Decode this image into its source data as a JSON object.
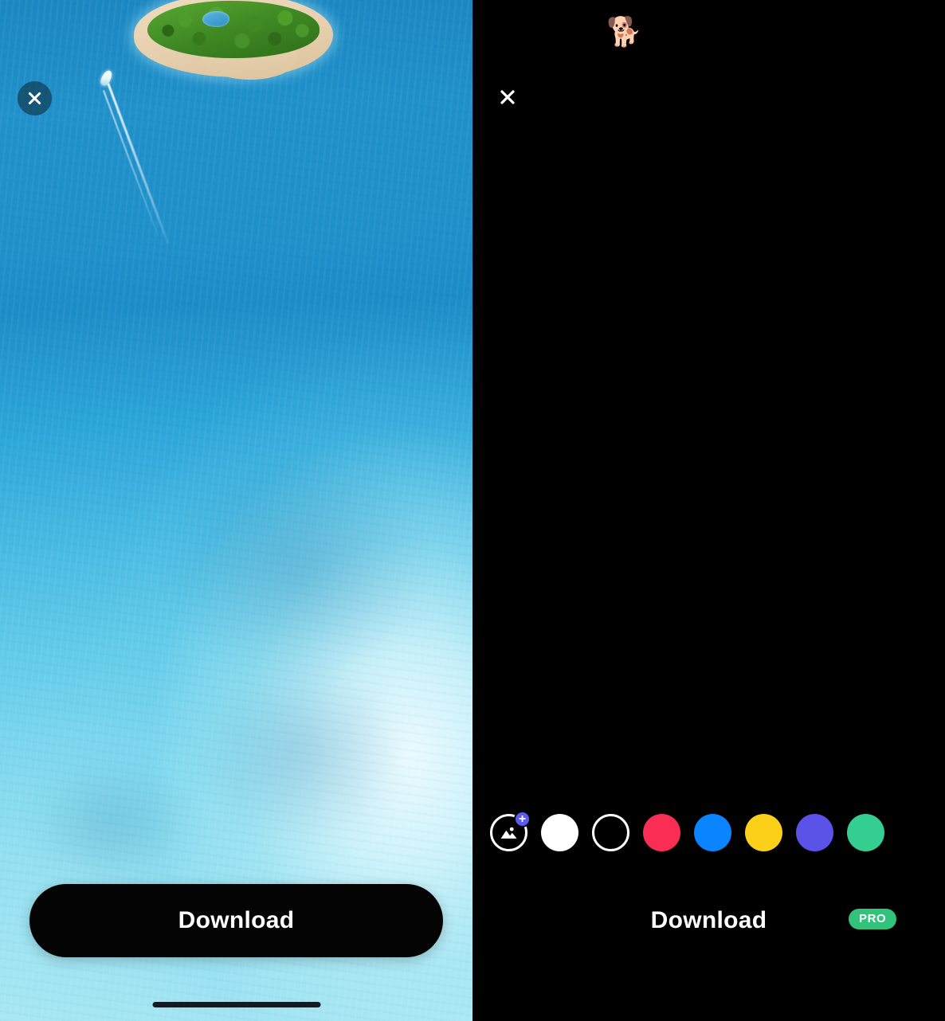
{
  "screens": {
    "left": {
      "name": "wallpaper-preview",
      "close_icon": "close-icon",
      "background_description": "aerial photo of tropical island with boat wake in turquoise sea",
      "download_label": "Download",
      "home_indicator": "home-indicator"
    },
    "right": {
      "name": "wallpaper-editor",
      "close_icon": "close-icon",
      "canvas": {
        "sticker": "🐕"
      },
      "background_picker": {
        "photo_option": {
          "icon": "add-photo-icon",
          "badge": "+",
          "badge_color": "#5B5BF0"
        },
        "swatches": [
          {
            "name": "white",
            "color": "#FFFFFF",
            "style": "solid"
          },
          {
            "name": "black",
            "color": "#000000",
            "style": "outline"
          },
          {
            "name": "pink",
            "color": "#FA2E55",
            "style": "solid"
          },
          {
            "name": "blue",
            "color": "#0A84FF",
            "style": "solid"
          },
          {
            "name": "yellow",
            "color": "#FCD019",
            "style": "solid"
          },
          {
            "name": "purple",
            "color": "#5B52E8",
            "style": "solid"
          },
          {
            "name": "green",
            "color": "#34CE92",
            "style": "solid"
          }
        ]
      },
      "download_label": "Download",
      "pro_badge": {
        "label": "PRO",
        "color": "#31C27C"
      }
    }
  }
}
